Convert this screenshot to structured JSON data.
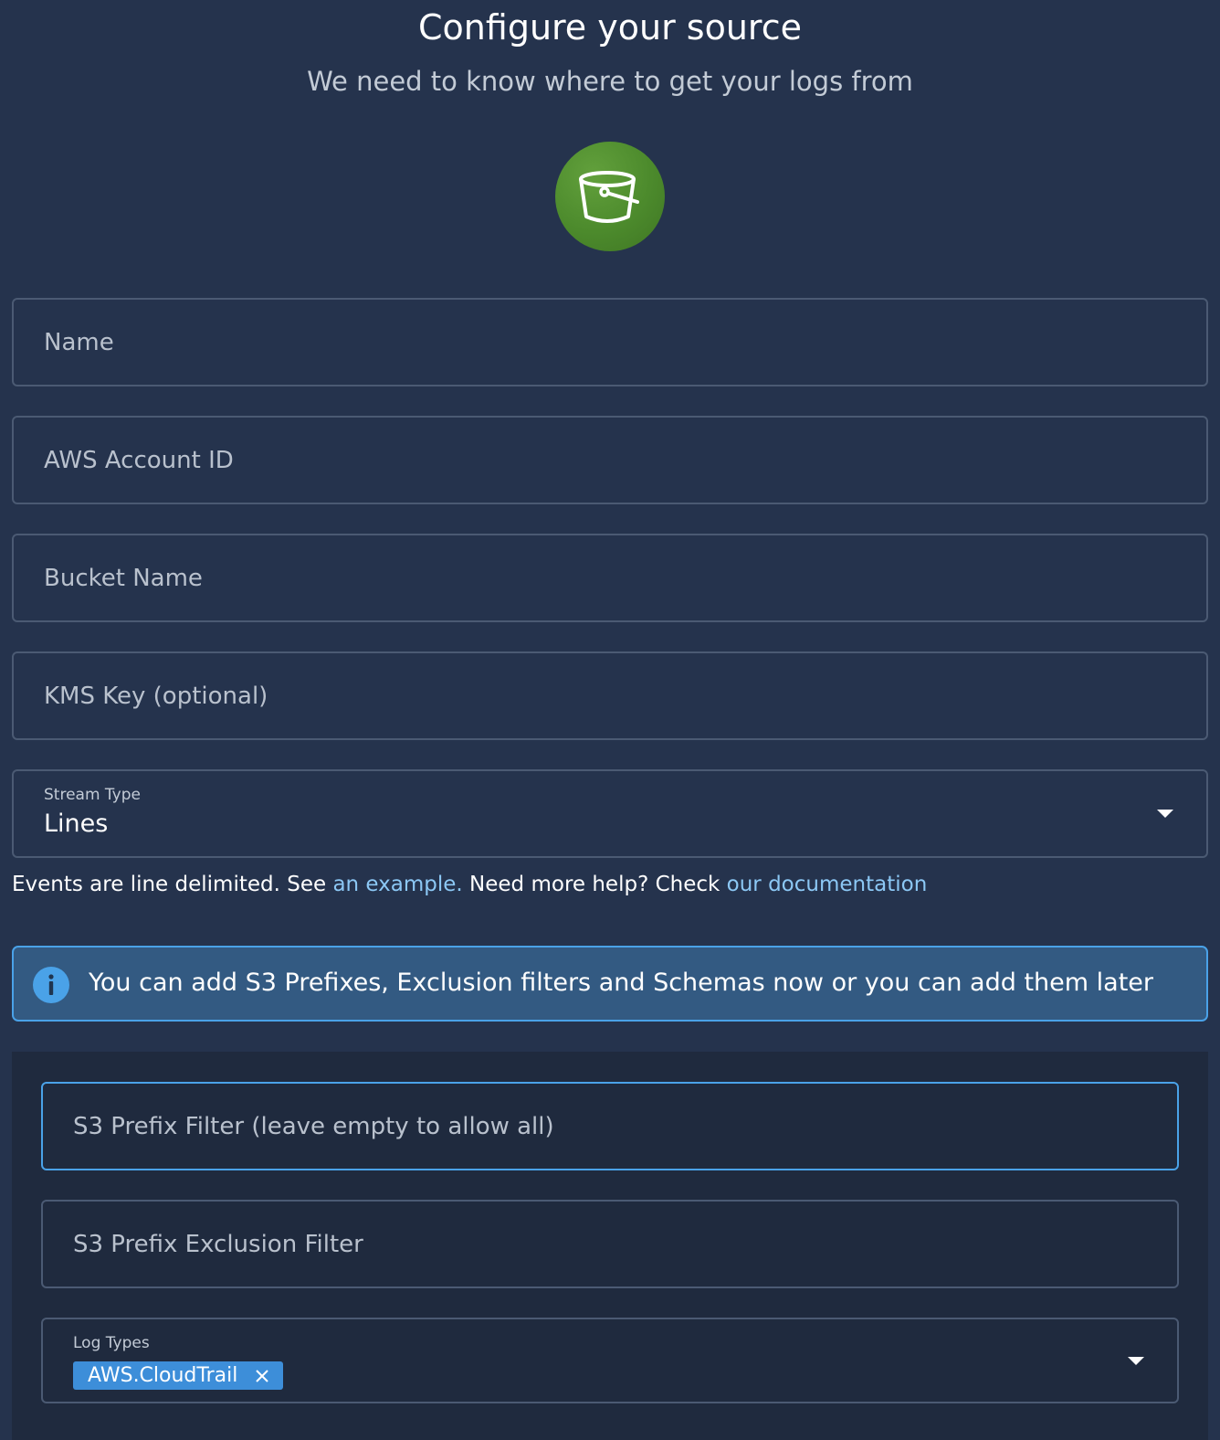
{
  "header": {
    "title": "Configure your source",
    "subtitle": "We need to know where to get your logs from",
    "logo_icon": "s3-bucket-icon",
    "logo_color": "#4c8a2c"
  },
  "form": {
    "name": {
      "placeholder": "Name",
      "value": ""
    },
    "aws_account_id": {
      "placeholder": "AWS Account ID",
      "value": ""
    },
    "bucket_name": {
      "placeholder": "Bucket Name",
      "value": ""
    },
    "kms_key": {
      "placeholder": "KMS Key (optional)",
      "value": ""
    },
    "stream_type": {
      "label": "Stream Type",
      "value": "Lines",
      "icon": "chevron-down-icon"
    },
    "help": {
      "prefix": "Events are line delimited. See ",
      "example_link": "an example.",
      "middle": " Need more help? Check ",
      "docs_link": "our documentation"
    }
  },
  "info_banner": {
    "icon": "info-icon",
    "text": "You can add S3 Prefixes, Exclusion filters and Schemas now or you can add them later",
    "border_color": "#4aa2e8",
    "background_color": "#335a82"
  },
  "prefix_panel": {
    "prefix_filter": {
      "placeholder": "S3 Prefix Filter (leave empty to allow all)",
      "value": ""
    },
    "exclusion_filter": {
      "placeholder": "S3 Prefix Exclusion Filter",
      "value": ""
    },
    "log_types": {
      "label": "Log Types",
      "selected": [
        "AWS.CloudTrail"
      ],
      "chip_color": "#3d8ed9",
      "icon": "chevron-down-icon"
    }
  },
  "colors": {
    "background": "#25334d",
    "panel_background": "#1f2a3e",
    "link": "#8cc8f5",
    "field_border": "#4b5a73"
  }
}
